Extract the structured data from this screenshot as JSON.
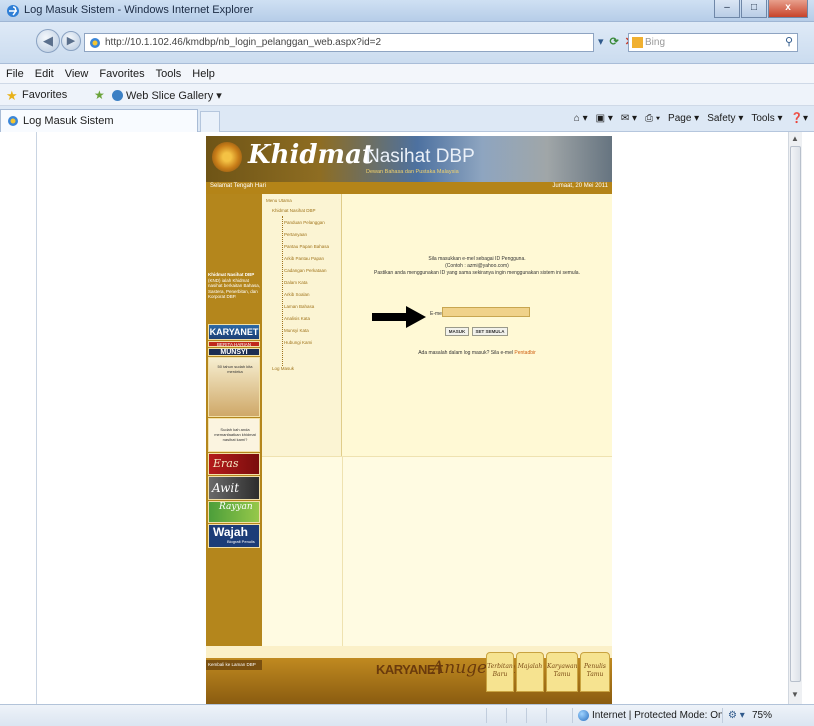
{
  "window": {
    "title": "Log Masuk Sistem - Windows Internet Explorer",
    "minimize": "–",
    "maximize": "□",
    "close": "x"
  },
  "address_bar": {
    "url": "http://10.1.102.46/kmdbp/nb_login_pelanggan_web.aspx?id=2",
    "search_placeholder": "Bing",
    "search_icon": "magnifier-icon"
  },
  "menu": [
    "File",
    "Edit",
    "View",
    "Favorites",
    "Tools",
    "Help"
  ],
  "favorites_bar": {
    "favorites_label": "Favorites",
    "web_slice_label": "Web Slice Gallery ▾"
  },
  "tab": {
    "label": "Log Masuk Sistem"
  },
  "command_bar": [
    "Page ▾",
    "Safety ▾",
    "Tools ▾"
  ],
  "site": {
    "logo_script": "Khidmat",
    "logo_rest": "Nasihat DBP",
    "logo_sub": "Dewan Bahasa dan Pustaka Malaysia",
    "greeting": "Selamat Tengah Hari",
    "date": "Jumaat, 20 Mei 2011",
    "intro_title": "Khidmat Nasihat DBP",
    "intro_text": "(KND) ialah Khidmat nasihat berkaitan Bahasa, Sastera, Penerbitan, dan Korporat DBP.",
    "tree": [
      "Menu Utama",
      "Khidmat Nasihat DBP",
      "Panduan Pelanggan",
      "Pertanyaan",
      "Pantau Papan Bahasa",
      "Arkib Pantau Papan",
      "Cadangan Perkataan",
      "Dalam Kata",
      "Arkib Soalan",
      "Laman Bahasa",
      "Analisis Kata",
      "Munsyi Kata",
      "Hubungi Kami",
      "Log Masuk"
    ],
    "login": {
      "line1": "Sila masukkan e-mel sebagai ID Pengguna.",
      "line2": "(Contoh : azmi@yahoo.com)",
      "line3": "Pastikan anda menggunakan ID yang sama sekiranya ingin menggunakan sistem ini semula.",
      "email_label": "E-mel",
      "required_mark": "*",
      "email_value": "",
      "submit": "MASUK",
      "reset": "SET SEMULA",
      "help_text": "Ada masalah dalam log masuk? Sila e-mel ",
      "help_link": "Pentadbir"
    },
    "promos": {
      "karyanet": "KARYANET",
      "berita": "BERITA HARIAN",
      "munsyi": "MUNSYI",
      "munsyi_sub": "50 tahun sudah kita merdeka",
      "cartoon_text": "Sudah kah anda memanfaatkan khidmat nasihat kami?",
      "brand1": "Eras",
      "brand2": "Awit",
      "brand3": "Rayyan",
      "wajah": "Wajah",
      "wajah_sub": "Biografi Penulis"
    },
    "back_link": "Kembali ke Laman DBP",
    "footer": {
      "karnet": "KARYANET",
      "anugerah": "Anugerah",
      "terbitan": "Terbitan Baru",
      "majalah": "Majalah",
      "karyawan": "Karyawan Tamu",
      "penulis": "Penulis Tamu"
    }
  },
  "status_bar": {
    "zone": "Internet | Protected Mode: On",
    "zoom": "75%",
    "addons": "⚙ ▾"
  }
}
